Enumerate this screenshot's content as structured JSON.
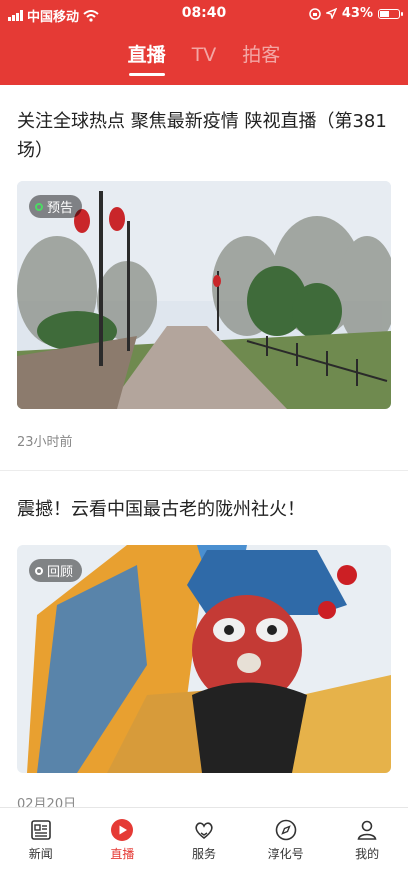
{
  "status_bar": {
    "carrier": "中国移动",
    "time": "08:40",
    "battery": "43%",
    "battery_level": 0.43
  },
  "tabs": [
    {
      "label": "直播",
      "active": true
    },
    {
      "label": "TV",
      "active": false
    },
    {
      "label": "拍客",
      "active": false
    }
  ],
  "feed": [
    {
      "title": "关注全球热点 聚焦最新疫情 陕视直播（第381场）",
      "badge": "预告",
      "time": "23小时前"
    },
    {
      "title": "震撼！云看中国最古老的陇州社火！",
      "badge": "回顾",
      "time": "02月20日"
    }
  ],
  "bottom_nav": [
    {
      "label": "新闻",
      "icon": "news-icon",
      "active": false
    },
    {
      "label": "直播",
      "icon": "live-play-icon",
      "active": true
    },
    {
      "label": "服务",
      "icon": "service-heart-icon",
      "active": false
    },
    {
      "label": "淳化号",
      "icon": "compass-icon",
      "active": false
    },
    {
      "label": "我的",
      "icon": "profile-icon",
      "active": false
    }
  ],
  "colors": {
    "brand": "#e53a35",
    "badge_live": "#4cd964"
  }
}
